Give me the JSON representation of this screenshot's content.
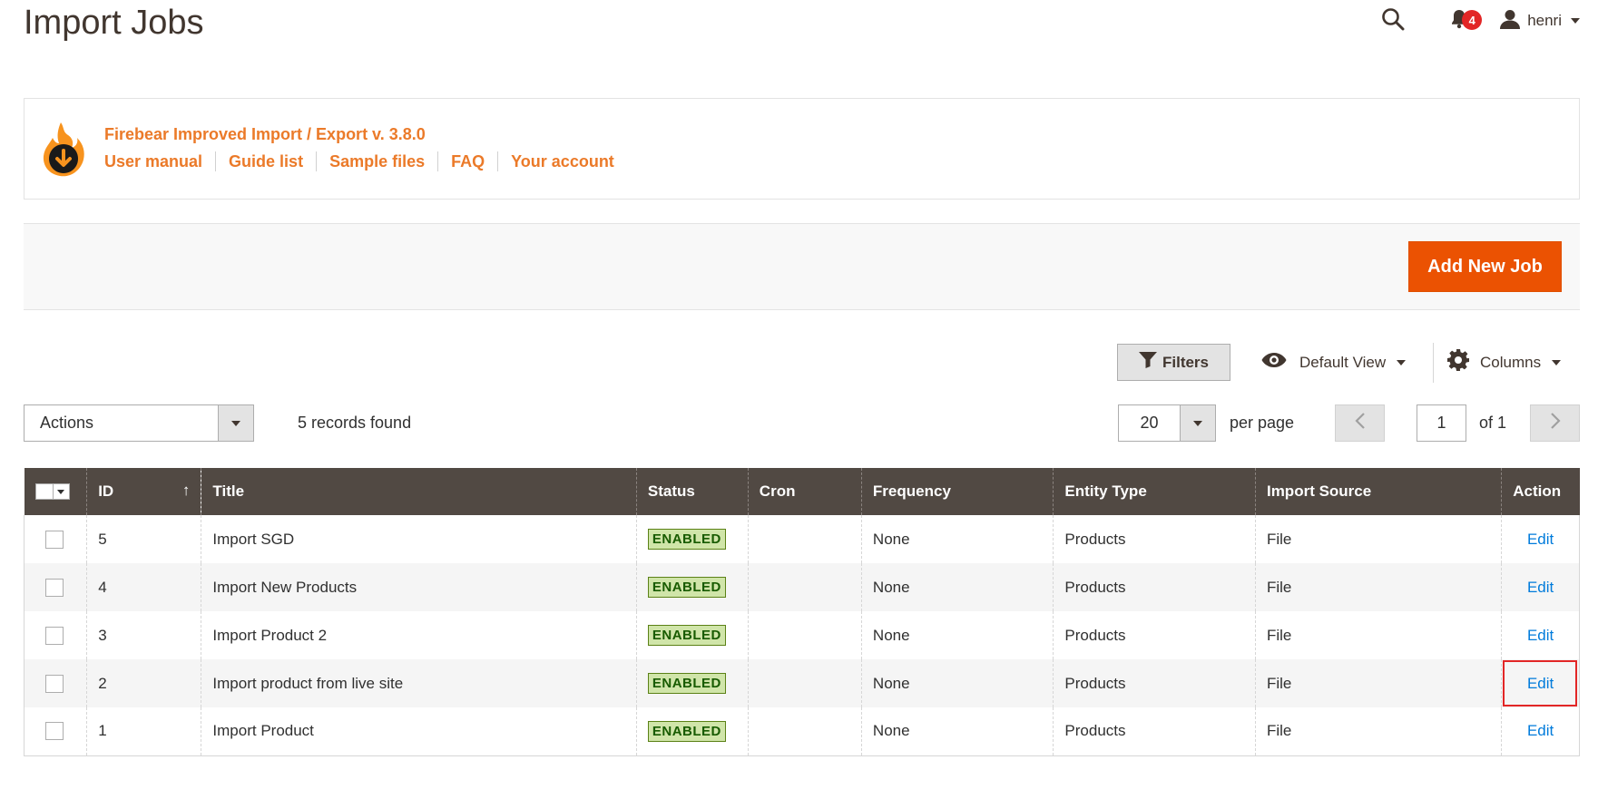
{
  "page": {
    "title": "Import Jobs"
  },
  "header": {
    "notification_count": "4",
    "username": "henri"
  },
  "firebear": {
    "title": "Firebear Improved Import / Export v. 3.8.0",
    "links": [
      "User manual",
      "Guide list",
      "Sample files",
      "FAQ",
      "Your account"
    ]
  },
  "action_bar": {
    "add_label": "Add New Job"
  },
  "toolbar": {
    "filters_label": "Filters",
    "view_label": "Default View",
    "columns_label": "Columns",
    "actions_label": "Actions",
    "records_text": "5 records found",
    "per_page_value": "20",
    "per_page_label": "per page",
    "page_value": "1",
    "page_of": "of 1"
  },
  "grid": {
    "columns": [
      "ID",
      "Title",
      "Status",
      "Cron",
      "Frequency",
      "Entity Type",
      "Import Source",
      "Action"
    ],
    "sort_indicator": "↑",
    "rows": [
      {
        "id": "5",
        "title": "Import SGD",
        "status": "ENABLED",
        "cron": "",
        "frequency": "None",
        "entity": "Products",
        "source": "File",
        "action": "Edit"
      },
      {
        "id": "4",
        "title": "Import New Products",
        "status": "ENABLED",
        "cron": "",
        "frequency": "None",
        "entity": "Products",
        "source": "File",
        "action": "Edit"
      },
      {
        "id": "3",
        "title": "Import Product 2",
        "status": "ENABLED",
        "cron": "",
        "frequency": "None",
        "entity": "Products",
        "source": "File",
        "action": "Edit"
      },
      {
        "id": "2",
        "title": "Import product from live site",
        "status": "ENABLED",
        "cron": "",
        "frequency": "None",
        "entity": "Products",
        "source": "File",
        "action": "Edit"
      },
      {
        "id": "1",
        "title": "Import Product",
        "status": "ENABLED",
        "cron": "",
        "frequency": "None",
        "entity": "Products",
        "source": "File",
        "action": "Edit"
      }
    ]
  },
  "colors": {
    "accent": "#eb5202",
    "brand": "#eb7a29",
    "header_bg": "#514943",
    "highlight": "#e22626",
    "link": "#007bdb"
  },
  "icons": [
    "search-icon",
    "bell-icon",
    "user-icon",
    "firebear-logo-icon",
    "filter-icon",
    "eye-icon",
    "gear-icon",
    "chevron-left-icon",
    "chevron-right-icon"
  ]
}
